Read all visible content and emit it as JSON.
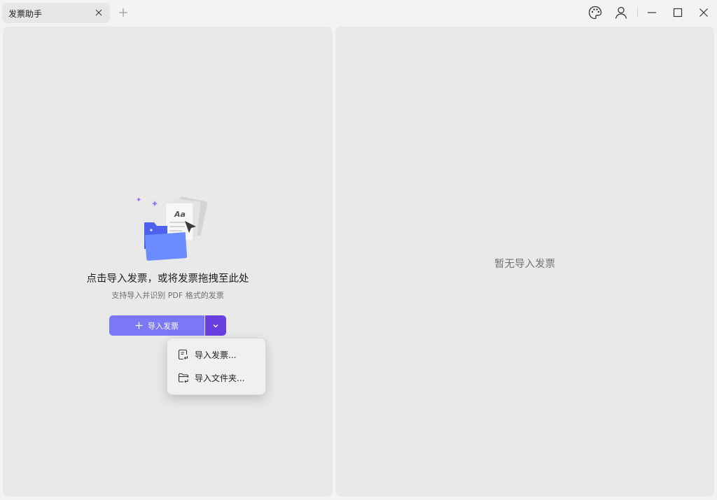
{
  "tab": {
    "title": "发票助手"
  },
  "left_panel": {
    "main_text": "点击导入发票，或将发票拖拽至此处",
    "sub_text": "支持导入并识别 PDF 格式的发票",
    "import_button_label": "导入发票",
    "illustration_text": "Aa"
  },
  "right_panel": {
    "empty_text": "暂无导入发票"
  },
  "menu": {
    "items": [
      {
        "label": "导入发票...",
        "icon": "invoice-file-icon"
      },
      {
        "label": "导入文件夹...",
        "icon": "folder-import-icon"
      }
    ]
  },
  "colors": {
    "primary_button": "#7b78f6",
    "dropdown_button": "#6a3fe0",
    "folder_blue": "#5b7cfa"
  }
}
